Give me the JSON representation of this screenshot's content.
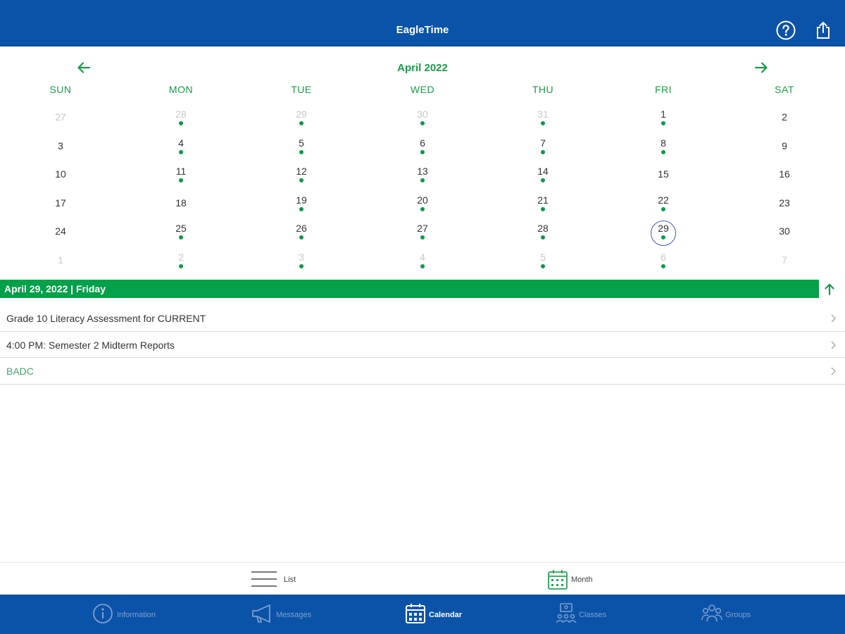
{
  "header": {
    "title": "EagleTime",
    "help_icon": "question-circle-icon",
    "share_icon": "share-icon"
  },
  "calendar": {
    "month_label": "April 2022",
    "prev_icon": "arrow-left-icon",
    "next_icon": "arrow-right-icon",
    "accent_color": "#1a9b48",
    "weekdays": [
      "SUN",
      "MON",
      "TUE",
      "WED",
      "THU",
      "FRI",
      "SAT"
    ],
    "weeks": [
      [
        {
          "d": "27",
          "muted": true,
          "dot": false
        },
        {
          "d": "28",
          "muted": true,
          "dot": true
        },
        {
          "d": "29",
          "muted": true,
          "dot": true
        },
        {
          "d": "30",
          "muted": true,
          "dot": true
        },
        {
          "d": "31",
          "muted": true,
          "dot": true
        },
        {
          "d": "1",
          "muted": false,
          "dot": true
        },
        {
          "d": "2",
          "muted": false,
          "dot": false
        }
      ],
      [
        {
          "d": "3",
          "muted": false,
          "dot": false
        },
        {
          "d": "4",
          "muted": false,
          "dot": true
        },
        {
          "d": "5",
          "muted": false,
          "dot": true
        },
        {
          "d": "6",
          "muted": false,
          "dot": true
        },
        {
          "d": "7",
          "muted": false,
          "dot": true
        },
        {
          "d": "8",
          "muted": false,
          "dot": true
        },
        {
          "d": "9",
          "muted": false,
          "dot": false
        }
      ],
      [
        {
          "d": "10",
          "muted": false,
          "dot": false
        },
        {
          "d": "11",
          "muted": false,
          "dot": true
        },
        {
          "d": "12",
          "muted": false,
          "dot": true
        },
        {
          "d": "13",
          "muted": false,
          "dot": true
        },
        {
          "d": "14",
          "muted": false,
          "dot": true
        },
        {
          "d": "15",
          "muted": false,
          "dot": false
        },
        {
          "d": "16",
          "muted": false,
          "dot": false
        }
      ],
      [
        {
          "d": "17",
          "muted": false,
          "dot": false
        },
        {
          "d": "18",
          "muted": false,
          "dot": false
        },
        {
          "d": "19",
          "muted": false,
          "dot": true
        },
        {
          "d": "20",
          "muted": false,
          "dot": true
        },
        {
          "d": "21",
          "muted": false,
          "dot": true
        },
        {
          "d": "22",
          "muted": false,
          "dot": true
        },
        {
          "d": "23",
          "muted": false,
          "dot": false
        }
      ],
      [
        {
          "d": "24",
          "muted": false,
          "dot": false
        },
        {
          "d": "25",
          "muted": false,
          "dot": true
        },
        {
          "d": "26",
          "muted": false,
          "dot": true
        },
        {
          "d": "27",
          "muted": false,
          "dot": true
        },
        {
          "d": "28",
          "muted": false,
          "dot": true
        },
        {
          "d": "29",
          "muted": false,
          "dot": true,
          "selected": true
        },
        {
          "d": "30",
          "muted": false,
          "dot": false
        }
      ],
      [
        {
          "d": "1",
          "muted": true,
          "dot": false
        },
        {
          "d": "2",
          "muted": true,
          "dot": true
        },
        {
          "d": "3",
          "muted": true,
          "dot": true
        },
        {
          "d": "4",
          "muted": true,
          "dot": true
        },
        {
          "d": "5",
          "muted": true,
          "dot": true
        },
        {
          "d": "6",
          "muted": true,
          "dot": true
        },
        {
          "d": "7",
          "muted": true,
          "dot": false
        }
      ]
    ]
  },
  "selected_date": {
    "label": "April 29, 2022 | Friday",
    "band_color": "#04a04a",
    "collapse_icon": "arrow-up-icon"
  },
  "events": [
    {
      "text": "Grade 10 Literacy Assessment for CURRENT",
      "accent": false
    },
    {
      "text": "4:00 PM: Semester 2 Midterm Reports",
      "accent": false
    },
    {
      "text": "BADC",
      "accent": true
    }
  ],
  "view_toggle": {
    "list_label": "List",
    "list_icon": "list-lines-icon",
    "month_label": "Month",
    "month_icon": "calendar-grid-icon"
  },
  "tabbar": {
    "brand_color": "#0b53a8",
    "tabs": [
      {
        "label": "Information",
        "icon": "info-circle-icon",
        "active": false
      },
      {
        "label": "Messages",
        "icon": "megaphone-icon",
        "active": false
      },
      {
        "label": "Calendar",
        "icon": "calendar-icon",
        "active": true
      },
      {
        "label": "Classes",
        "icon": "classroom-icon",
        "active": false
      },
      {
        "label": "Groups",
        "icon": "people-group-icon",
        "active": false
      }
    ]
  }
}
